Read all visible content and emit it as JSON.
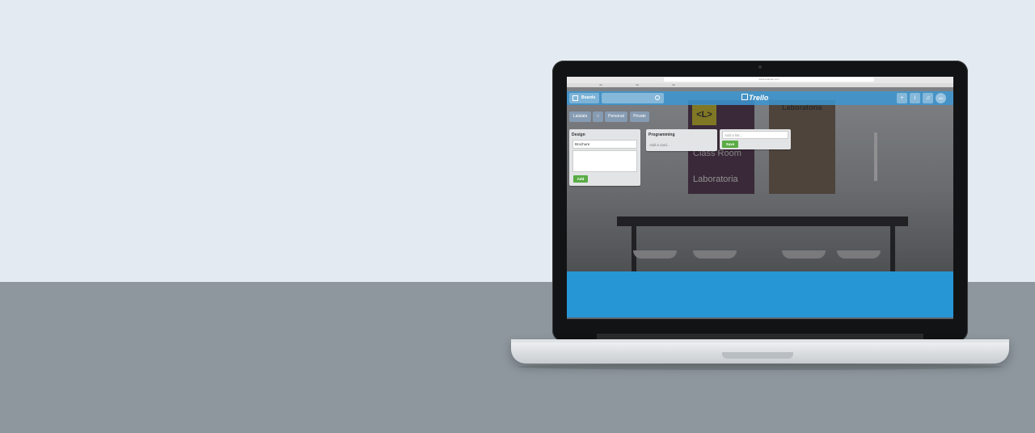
{
  "browser": {
    "url": "www.example.com",
    "tabs": [
      "tab",
      "tab",
      "tab"
    ],
    "dot_colors": [
      "#ff5f56",
      "#ffbd2e",
      "#27c93f"
    ]
  },
  "app": {
    "logo": "Trello",
    "boards_label": "Boards",
    "header_buttons": [
      "+",
      "i",
      "♫"
    ],
    "avatar_initials": "AA",
    "board_name": "Lalalala",
    "board_tags": [
      "Personal",
      "Private"
    ],
    "star_icon": "☆"
  },
  "lists": [
    {
      "title": "Design",
      "card_value": "Brochure",
      "add_button": "Add"
    },
    {
      "title": "Programming",
      "add_card": "Add a card..."
    }
  ],
  "new_list": {
    "placeholder": "Add a list...",
    "save_button": "Save"
  },
  "photo": {
    "poster1_badge": "<L>",
    "poster1_text": "Class Room",
    "poster1_title": "Laboratoria",
    "poster2_title": "Laboratoria"
  },
  "colors": {
    "accent": "#2696d4",
    "green": "#5aac44",
    "wall": "#e4eaf1",
    "desk": "#8d979d"
  }
}
